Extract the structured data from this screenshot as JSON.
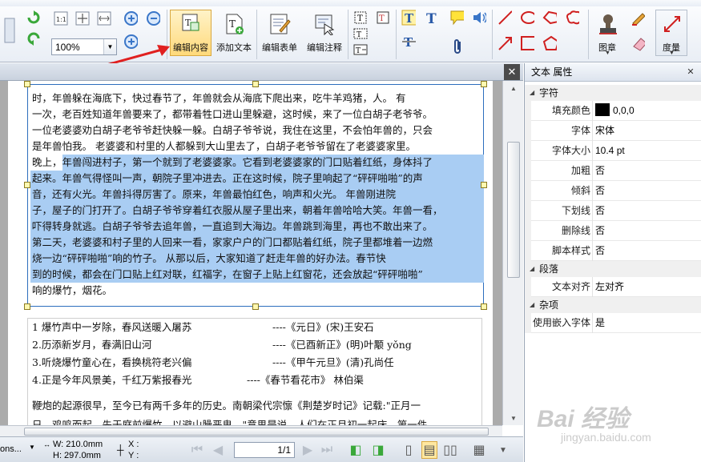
{
  "app": {
    "zoom": "100%",
    "accent_color": "#3a76c8",
    "selection_color": "#a9cdf3"
  },
  "ribbon": {
    "buttons": [
      {
        "name": "edit-content",
        "label": "编辑内容",
        "icon": "edit-content-icon",
        "active": true
      },
      {
        "name": "add-text",
        "label": "添加文本",
        "icon": "add-text-icon"
      },
      {
        "name": "edit-form",
        "label": "编辑表单",
        "icon": "edit-form-icon"
      },
      {
        "name": "edit-annotation",
        "label": "编辑注释",
        "icon": "edit-annotation-icon"
      },
      {
        "name": "stamp",
        "label": "图章",
        "icon": "stamp-icon"
      },
      {
        "name": "measure",
        "label": "度量",
        "icon": "measure-icon"
      }
    ]
  },
  "document": {
    "lines": [
      {
        "text": "时，年兽躲在海底下，快过春节了，年兽就会从海底下爬出来，吃牛羊鸡猪，人。          有",
        "sel": "none"
      },
      {
        "text": "一次，老百姓知道年兽要来了，都带着牲口进山里躲避，这时候，来了一位白胡子老爷爷。",
        "sel": "none"
      },
      {
        "text": "一位老婆婆劝白胡子老爷爷赶快躲一躲。白胡子爷爷说，我住在这里，不会怕年兽的，只会",
        "sel": "none"
      },
      {
        "text": "是年兽怕我。        老婆婆和村里的人都躲到大山里去了，白胡子老爷爷留在了老婆婆家里。",
        "sel": "none"
      },
      {
        "text": "晚上，年兽闯进村子，第一个就到了老婆婆家。它看到老婆婆家的门口贴着红纸，身体抖了",
        "sel": "partial"
      },
      {
        "text": "起来。年兽气得怪叫一声，朝院子里冲进去。正在这时候，院子里响起了“砰砰啪啪”的声",
        "sel": "full"
      },
      {
        "text": "音，还有火光。年兽抖得厉害了。原来，年兽最怕红色，响声和火光。          年兽刚进院",
        "sel": "full"
      },
      {
        "text": "子，屋子的门打开了。白胡子爷爷穿着红衣服从屋子里出来，朝着年兽哈哈大笑。年兽一看，",
        "sel": "full"
      },
      {
        "text": "吓得转身就逃。白胡子爷爷去追年兽，一直追到大海边。年兽跳到海里，再也不敢出来了。",
        "sel": "full"
      },
      {
        "text": "第二天，老婆婆和村子里的人回来一看，家家户户的门口都贴着红纸，院子里都堆着一边燃",
        "sel": "full"
      },
      {
        "text": "烧一边“砰砰啪啪”响的竹子。        从那以后，大家知道了赶走年兽的好办法。春节快",
        "sel": "full"
      },
      {
        "text": "到的时候，都会在门口贴上红对联，红福字，在窗子上贴上红窗花，还会放起“砰砰啪啪”",
        "sel": "full"
      },
      {
        "text": "响的爆竹，烟花。",
        "sel": "none"
      }
    ],
    "poems": [
      {
        "line": "1 爆竹声中一岁除，春风送暖入屠苏",
        "source": "----《元日》(宋)王安石"
      },
      {
        "line": "2.历添新岁月，春满旧山河",
        "source": "----《已酉新正》(明)叶颙 yǒng"
      },
      {
        "line": "3.听烧爆竹童心在，看换桃符老兴偏",
        "source": "----《甲午元旦》(清)孔尚任"
      },
      {
        "line": "4.正是今年风景美，千红万紫报春光",
        "source": "----《春节看花市》  林伯渠"
      }
    ],
    "paragraph": "鞭炮的起源很早，至今已有两千多年的历史。南朝梁代宗懔《荆楚岁时记》记载:\"正月一",
    "paragraph_cut": "日，鸡鸣而起，先于庭前爆竹，以避山臊恶鬼。\"意思是说，人们在正月初一起床，第一件"
  },
  "status": {
    "left_text": "ons...",
    "width": "W: 210.0mm",
    "height": "H: 297.0mm",
    "x": "X :",
    "y": "Y :",
    "page": "1/1"
  },
  "properties": {
    "title": "文本 属性",
    "close": "✕",
    "sections": [
      {
        "title": "字符",
        "rows": [
          {
            "name": "填充颜色",
            "value": "0,0,0",
            "swatch": "#000000"
          },
          {
            "name": "字体",
            "value": "宋体"
          },
          {
            "name": "字体大小",
            "value": "10.4 pt"
          },
          {
            "name": "加粗",
            "value": "否"
          },
          {
            "name": "倾斜",
            "value": "否"
          },
          {
            "name": "下划线",
            "value": "否"
          },
          {
            "name": "删除线",
            "value": "否"
          },
          {
            "name": "脚本样式",
            "value": "否"
          }
        ]
      },
      {
        "title": "段落",
        "rows": [
          {
            "name": "文本对齐",
            "value": "左对齐"
          }
        ]
      },
      {
        "title": "杂项",
        "rows": [
          {
            "name": "使用嵌入字体",
            "value": "是"
          }
        ]
      }
    ]
  },
  "watermark": {
    "main": "Bai 经验",
    "sub": "jingyan.baidu.com"
  }
}
